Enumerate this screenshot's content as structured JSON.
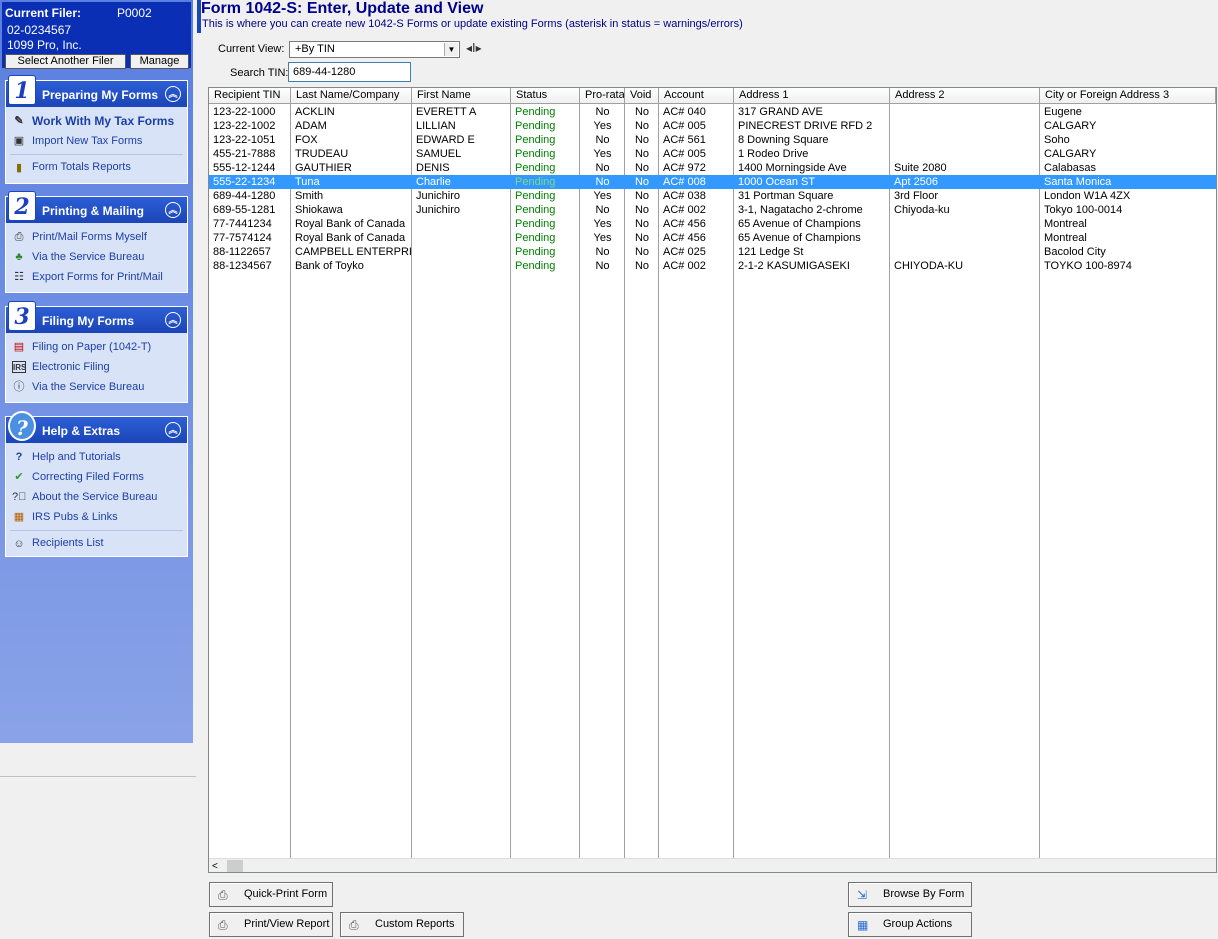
{
  "filer": {
    "label": "Current Filer:",
    "code": "P0002",
    "ein": "02-0234567",
    "name": "1099 Pro, Inc.",
    "select_button": "Select Another Filer",
    "manage_button": "Manage"
  },
  "panels": [
    {
      "number": "1",
      "title": "Preparing My Forms",
      "items": [
        {
          "label": "Work With My Tax Forms",
          "icon": "pen-icon"
        },
        {
          "label": "Import New Tax Forms",
          "icon": "import-icon"
        },
        {
          "label": "Form Totals Reports",
          "icon": "book-icon"
        }
      ]
    },
    {
      "number": "2",
      "title": "Printing & Mailing",
      "items": [
        {
          "label": "Print/Mail Forms Myself",
          "icon": "printer-icon"
        },
        {
          "label": "Via the Service Bureau",
          "icon": "service-bureau-icon"
        },
        {
          "label": "Export Forms for Print/Mail",
          "icon": "export-icon"
        }
      ]
    },
    {
      "number": "3",
      "title": "Filing My Forms",
      "items": [
        {
          "label": "Filing on Paper (1042-T)",
          "icon": "paper-form-icon"
        },
        {
          "label": "Electronic Filing",
          "icon": "irs-icon"
        },
        {
          "label": "Via the Service Bureau",
          "icon": "info-icon"
        }
      ]
    },
    {
      "number": "?",
      "title": "Help & Extras",
      "items": [
        {
          "label": "Help and Tutorials",
          "icon": "question-icon"
        },
        {
          "label": "Correcting Filed Forms",
          "icon": "checkmark-icon"
        },
        {
          "label": "About the Service Bureau",
          "icon": "question-circle-icon"
        },
        {
          "label": "IRS Pubs & Links",
          "icon": "document-icon"
        },
        {
          "label": "Recipients List",
          "icon": "people-icon"
        }
      ]
    }
  ],
  "header": {
    "title": "Form 1042-S: Enter, Update and View",
    "subtitle": "This is where you can create new 1042-S Forms or update existing Forms (asterisk in status = warnings/errors)"
  },
  "controls": {
    "view_label": "Current View:",
    "view_value": "+By TIN",
    "search_label": "Search TIN:",
    "search_value": "689-44-1280"
  },
  "grid": {
    "columns": [
      "Recipient TIN",
      "Last Name/Company",
      "First Name",
      "Status",
      "Pro-rata",
      "Void",
      "Account",
      "Address 1",
      "Address 2",
      "City or Foreign Address 3"
    ],
    "selected_row": 5,
    "rows": [
      [
        "123-22-1000",
        "ACKLIN",
        "EVERETT A",
        "Pending",
        "No",
        "No",
        "AC#  040",
        "317 GRAND AVE",
        "",
        "Eugene"
      ],
      [
        "123-22-1002",
        "ADAM",
        "LILLIAN",
        "Pending",
        "Yes",
        "No",
        "AC#  005",
        "PINECREST DRIVE RFD 2",
        "",
        "CALGARY"
      ],
      [
        "123-22-1051",
        "FOX",
        "EDWARD E",
        "Pending",
        "No",
        "No",
        "AC#  561",
        "8 Downing Square",
        "",
        "Soho"
      ],
      [
        "455-21-7888",
        "TRUDEAU",
        "SAMUEL",
        "Pending",
        "Yes",
        "No",
        "AC#  005",
        "1 Rodeo Drive",
        "",
        "CALGARY"
      ],
      [
        "555-12-1244",
        "GAUTHIER",
        "DENIS",
        "Pending",
        "No",
        "No",
        "AC#  972",
        "1400 Morningside Ave",
        "Suite 2080",
        "Calabasas"
      ],
      [
        "555-22-1234",
        "Tuna",
        "Charlie",
        "Pending",
        "No",
        "No",
        "AC#  008",
        "1000 Ocean ST",
        "Apt 2506",
        "Santa Monica"
      ],
      [
        "689-44-1280",
        "Smith",
        "Junichiro",
        "Pending",
        "Yes",
        "No",
        "AC#  038",
        "31 Portman Square",
        "3rd Floor",
        "London W1A 4ZX"
      ],
      [
        "689-55-1281",
        "Shiokawa",
        "Junichiro",
        "Pending",
        "No",
        "No",
        "AC#  002",
        "3-1,  Nagatacho 2-chrome",
        "Chiyoda-ku",
        "Tokyo 100-0014"
      ],
      [
        "77-7441234",
        "Royal Bank of Canada",
        "",
        "Pending",
        "Yes",
        "No",
        "AC#  456",
        "65 Avenue of Champions",
        "",
        "Montreal"
      ],
      [
        "77-7574124",
        "Royal Bank of Canada",
        "",
        "Pending",
        "Yes",
        "No",
        "AC#  456",
        "65 Avenue of Champions",
        "",
        "Montreal"
      ],
      [
        "88-1122657",
        "CAMPBELL ENTERPRISES",
        "",
        "Pending",
        "No",
        "No",
        "AC#  025",
        "121 Ledge St",
        "",
        "Bacolod City"
      ],
      [
        "88-1234567",
        "Bank of Toyko",
        "",
        "Pending",
        "No",
        "No",
        "AC#  002",
        "2-1-2 KASUMIGASEKI",
        "CHIYODA-KU",
        "TOYKO 100-8974"
      ]
    ]
  },
  "buttons": {
    "quick_print": "Quick-Print Form",
    "print_view_report": "Print/View Report",
    "custom_reports": "Custom Reports",
    "browse_by_form": "Browse By Form",
    "group_actions": "Group Actions"
  }
}
